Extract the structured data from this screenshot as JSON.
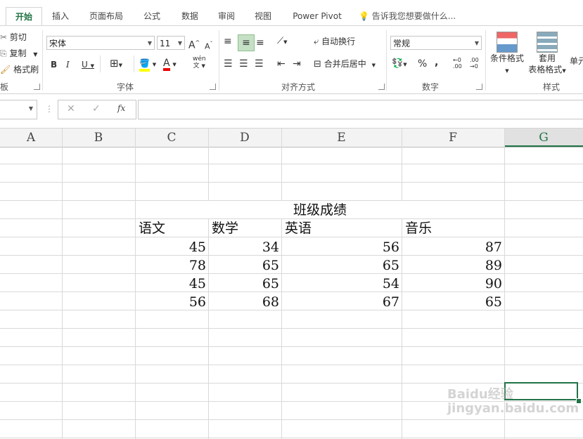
{
  "ribbon_tabs": [
    "开始",
    "插入",
    "页面布局",
    "公式",
    "数据",
    "审阅",
    "视图",
    "Power Pivot"
  ],
  "tell_me": "告诉我您想要做什么...",
  "clipboard": {
    "cut": "剪切",
    "copy": "复制",
    "format_painter": "格式刷",
    "group": "板"
  },
  "font": {
    "name": "宋体",
    "size": "11",
    "grow": "A",
    "shrink": "A",
    "bold": "B",
    "italic": "I",
    "underline": "U",
    "pinyin": "wén",
    "font_color_letter": "A",
    "group": "字体"
  },
  "alignment": {
    "wrap_text": "自动换行",
    "merge_center": "合并后居中",
    "group": "对齐方式"
  },
  "number": {
    "format": "常规",
    "percent": "%",
    "comma": ",",
    "inc_decimal": "←0 .00",
    "dec_decimal": ".00 →0",
    "group": "数字"
  },
  "styles": {
    "conditional": "条件格式",
    "table_format_1": "套用",
    "table_format_2": "表格格式",
    "cell_styles": "单元",
    "group": "样式"
  },
  "formula_bar": {
    "fx": "fx",
    "cancel": "✕",
    "enter": "✓",
    "value": ""
  },
  "columns": [
    "A",
    "B",
    "C",
    "D",
    "E",
    "F",
    "G"
  ],
  "sheet": {
    "title": "班级成绩",
    "headers": [
      "语文",
      "数学",
      "英语",
      "音乐"
    ],
    "rows": [
      [
        "45",
        "34",
        "56",
        "87"
      ],
      [
        "78",
        "65",
        "65",
        "89"
      ],
      [
        "45",
        "65",
        "54",
        "90"
      ],
      [
        "56",
        "68",
        "67",
        "65"
      ]
    ]
  },
  "watermark": "Baidu经验 jingyan.baidu.com",
  "colors": {
    "accent": "#217346",
    "selected_header": "#e1e1e1"
  }
}
